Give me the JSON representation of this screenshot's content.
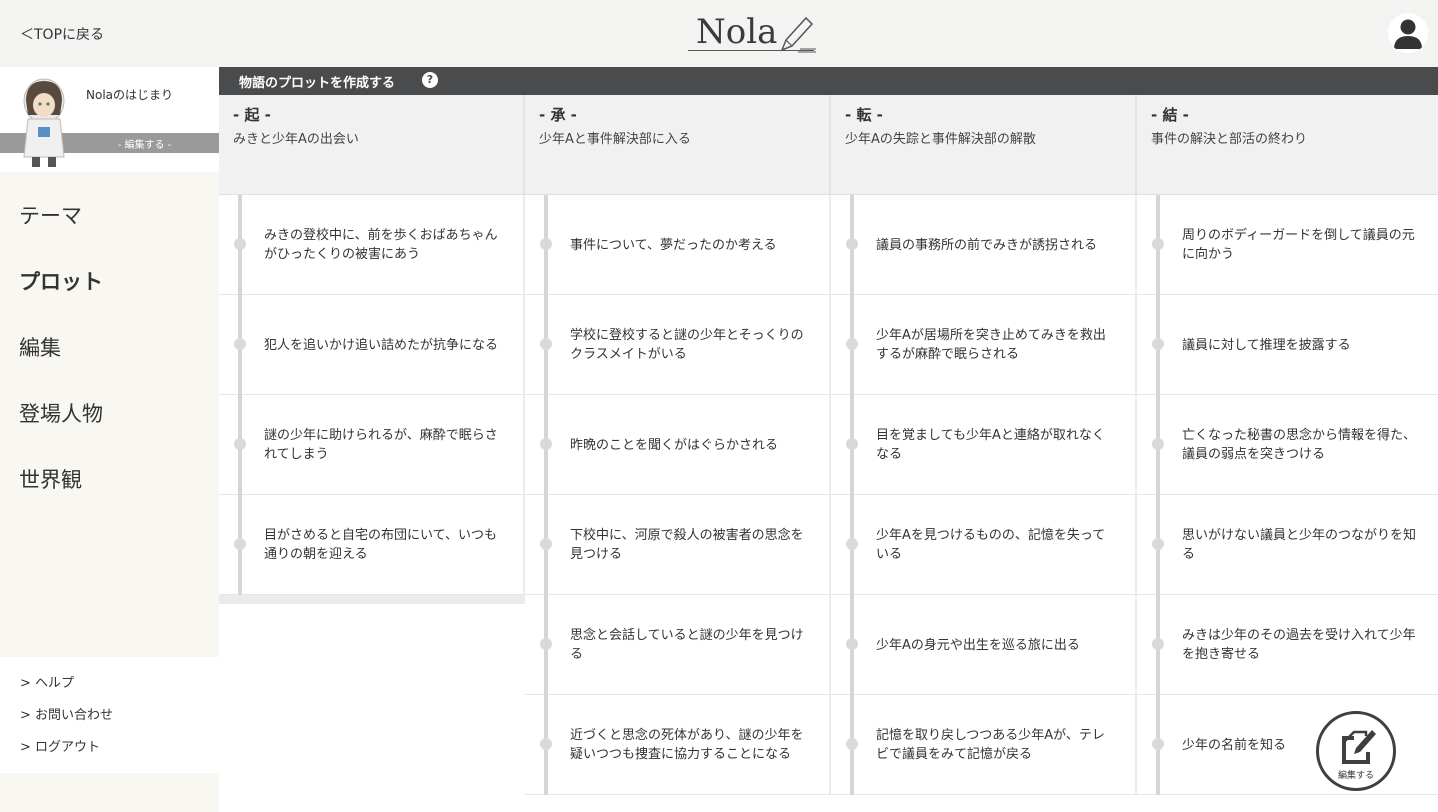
{
  "header": {
    "back_label": "＜TOPに戻る",
    "logo_text": "Nola"
  },
  "sidebar": {
    "project_title": "Nolaのはじまり",
    "project_edit_label": "- 編集する -",
    "nav": [
      {
        "label": "テーマ"
      },
      {
        "label": "プロット"
      },
      {
        "label": "編集"
      },
      {
        "label": "登場人物"
      },
      {
        "label": "世界観"
      }
    ],
    "links": [
      {
        "label": "> ヘルプ"
      },
      {
        "label": "> お問い合わせ"
      },
      {
        "label": "> ログアウト"
      }
    ]
  },
  "main": {
    "section_title": "物語のプロットを作成する",
    "help_glyph": "?",
    "columns": [
      {
        "name": "- 起 -",
        "subtitle": "みきと少年Aの出会い",
        "cards": [
          "みきの登校中に、前を歩くおばあちゃんがひったくりの被害にあう",
          "犯人を追いかけ追い詰めたが抗争になる",
          "謎の少年に助けられるが、麻酔で眠らされてしまう",
          "目がさめると自宅の布団にいて、いつも通りの朝を迎える"
        ]
      },
      {
        "name": "- 承 -",
        "subtitle": "少年Aと事件解決部に入る",
        "cards": [
          "事件について、夢だったのか考える",
          "学校に登校すると謎の少年とそっくりのクラスメイトがいる",
          "昨晩のことを聞くがはぐらかされる",
          "下校中に、河原で殺人の被害者の思念を見つける",
          "思念と会話していると謎の少年を見つける",
          "近づくと思念の死体があり、謎の少年を疑いつつも捜査に協力することになる"
        ]
      },
      {
        "name": "- 転 -",
        "subtitle": "少年Aの失踪と事件解決部の解散",
        "cards": [
          "議員の事務所の前でみきが誘拐される",
          "少年Aが居場所を突き止めてみきを救出するが麻酔で眠らされる",
          "目を覚ましても少年Aと連絡が取れなくなる",
          "少年Aを見つけるものの、記憶を失っている",
          "少年Aの身元や出生を巡る旅に出る",
          "記憶を取り戻しつつある少年Aが、テレビで議員をみて記憶が戻る"
        ]
      },
      {
        "name": "- 結 -",
        "subtitle": "事件の解決と部活の終わり",
        "cards": [
          "周りのボディーガードを倒して議員の元に向かう",
          "議員に対して推理を披露する",
          "亡くなった秘書の思念から情報を得た、議員の弱点を突きつける",
          "思いがけない議員と少年のつながりを知る",
          "みきは少年のその過去を受け入れて少年を抱き寄せる",
          "少年の名前を知る"
        ]
      }
    ]
  },
  "fab": {
    "label": "編集する"
  }
}
